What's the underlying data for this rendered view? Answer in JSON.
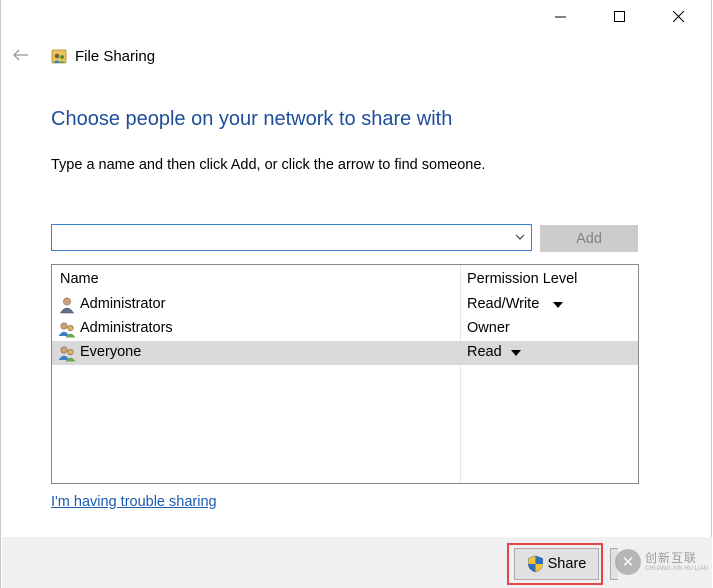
{
  "window": {
    "title": "File Sharing",
    "caption_buttons": [
      "minimize",
      "maximize",
      "close"
    ]
  },
  "heading": "Choose people on your network to share with",
  "instruction": "Type a name and then click Add, or click the arrow to find someone.",
  "name_input": {
    "value": "",
    "placeholder": ""
  },
  "add_button": {
    "label": "Add",
    "enabled": false
  },
  "list": {
    "columns": [
      "Name",
      "Permission Level"
    ],
    "rows": [
      {
        "name": "Administrator",
        "permission": "Read/Write",
        "has_dropdown": true,
        "icon": "user-icon",
        "selected": false
      },
      {
        "name": "Administrators",
        "permission": "Owner",
        "has_dropdown": false,
        "icon": "users-group-icon",
        "selected": false
      },
      {
        "name": "Everyone",
        "permission": "Read",
        "has_dropdown": true,
        "icon": "users-group-icon",
        "selected": true
      }
    ]
  },
  "trouble_link": "I'm having trouble sharing",
  "share_button": {
    "label": "Share",
    "icon": "uac-shield-icon"
  },
  "watermark": {
    "main": "创新互联",
    "sub": "CHUANG XIN HU LIAN"
  },
  "colors": {
    "heading": "#1e4e99",
    "link": "#1a5ab0",
    "selected_row": "#d9d9d9",
    "highlight_border": "#e04848",
    "footer": "#f0f0f0"
  }
}
